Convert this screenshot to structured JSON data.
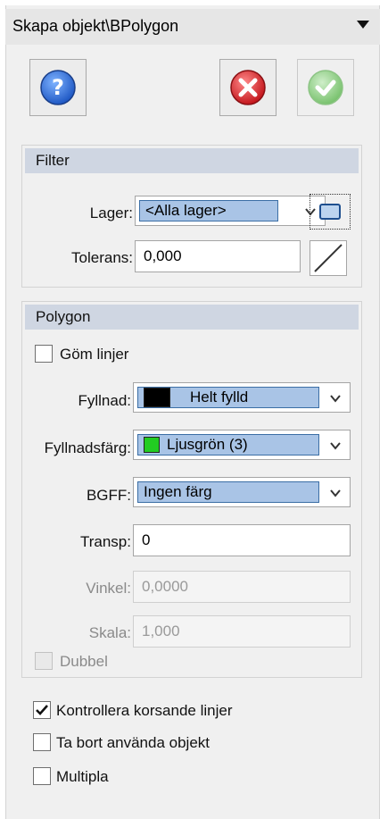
{
  "panel": {
    "title": "Skapa objekt\\BPolygon"
  },
  "toolbar": {
    "help_icon": "question-circle",
    "cancel_icon": "red-x-circle",
    "ok_icon": "green-check-circle"
  },
  "filter": {
    "header": "Filter",
    "lager_label": "Lager:",
    "lager_value": "<Alla lager>",
    "tolerans_label": "Tolerans:",
    "tolerans_value": "0,000"
  },
  "polygon": {
    "header": "Polygon",
    "gom_linjer_label": "Göm linjer",
    "gom_linjer_checked": false,
    "fyllnad_label": "Fyllnad:",
    "fyllnad_value": "Helt fylld",
    "fyllnad_color": "#000000",
    "fyllnadsfarg_label": "Fyllnadsfärg:",
    "fyllnadsfarg_value": "Ljusgrön (3)",
    "fyllnadsfarg_color": "#22cc22",
    "bgff_label": "BGFF:",
    "bgff_value": "Ingen färg",
    "transp_label": "Transp:",
    "transp_value": "0",
    "vinkel_label": "Vinkel:",
    "vinkel_value": "0,0000",
    "skala_label": "Skala:",
    "skala_value": "1,000",
    "dubbel_label": "Dubbel"
  },
  "options": {
    "kontrollera_label": "Kontrollera korsande linjer",
    "kontrollera_checked": true,
    "ta_bort_label": "Ta bort använda objekt",
    "ta_bort_checked": false,
    "multipla_label": "Multipla",
    "multipla_checked": false
  },
  "colors": {
    "selection_fill": "#a9c4e6",
    "selection_border": "#3b6ea5",
    "group_header": "#cfd6e2"
  }
}
